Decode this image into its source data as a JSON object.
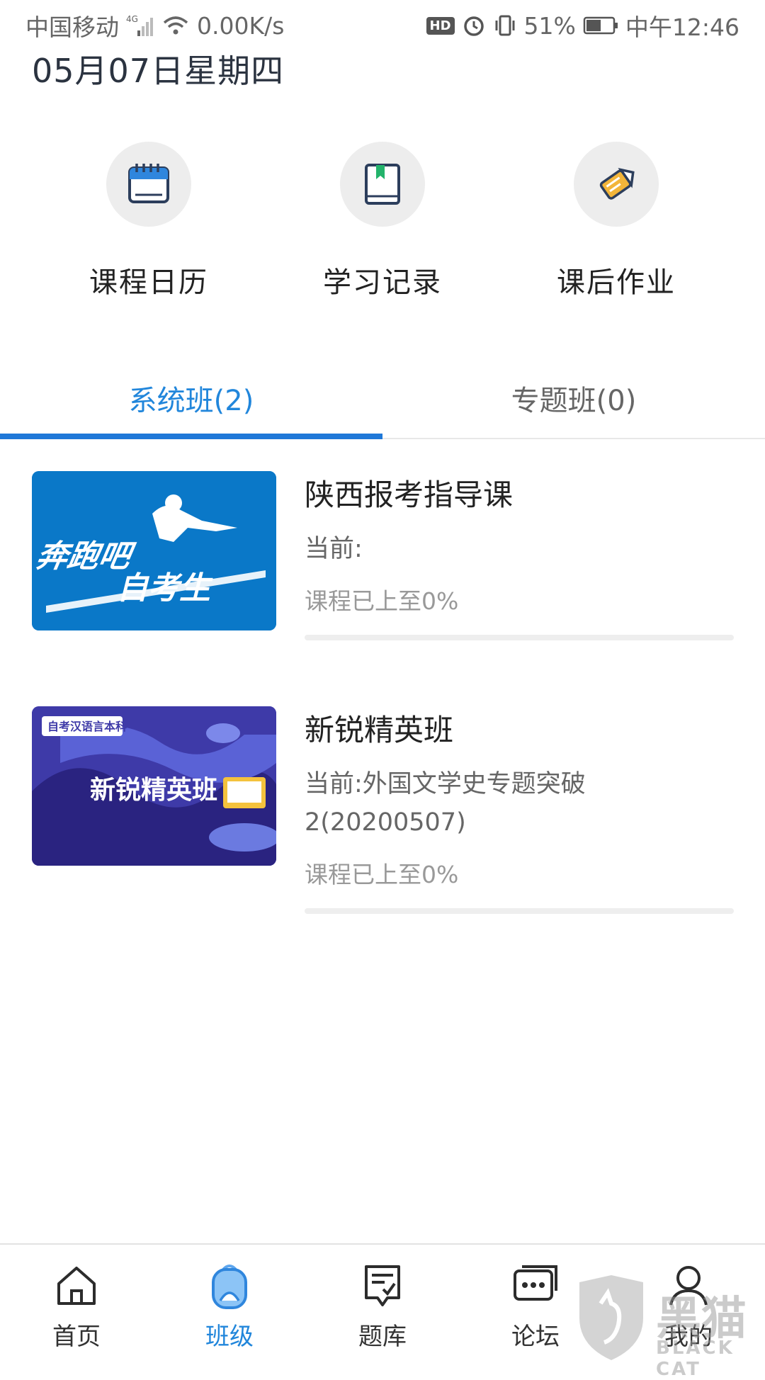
{
  "status_bar": {
    "carrier": "中国移动",
    "network": "4G",
    "speed": "0.00K/s",
    "hd": "HD",
    "battery": "51%",
    "time": "中午12:46"
  },
  "header": {
    "date": "05月07日星期四"
  },
  "quick_actions": [
    {
      "label": "课程日历",
      "icon": "calendar-icon"
    },
    {
      "label": "学习记录",
      "icon": "book-icon"
    },
    {
      "label": "课后作业",
      "icon": "pencil-icon"
    }
  ],
  "tabs": [
    {
      "label": "系统班(2)",
      "active": true
    },
    {
      "label": "专题班(0)",
      "active": false
    }
  ],
  "courses": [
    {
      "title": "陕西报考指导课",
      "current": "当前:",
      "progress_text": "课程已上至0%",
      "progress": 0,
      "thumb_text_1": "奔跑吧",
      "thumb_text_2": "自考生",
      "thumb_bg": "#0a78c8"
    },
    {
      "title": "新锐精英班",
      "current": "当前:外国文学史专题突破",
      "current_line2": "2(20200507)",
      "progress_text": "课程已上至0%",
      "progress": 0,
      "thumb_tag": "自考汉语言本科",
      "thumb_text": "新锐精英班",
      "thumb_bg": "#3e3aa8"
    }
  ],
  "bottom_nav": [
    {
      "label": "首页",
      "icon": "home-icon",
      "active": false
    },
    {
      "label": "班级",
      "icon": "backpack-icon",
      "active": true
    },
    {
      "label": "题库",
      "icon": "question-bank-icon",
      "active": false
    },
    {
      "label": "论坛",
      "icon": "chat-icon",
      "active": false
    },
    {
      "label": "我的",
      "icon": "user-icon",
      "active": false
    }
  ],
  "watermark": {
    "text": "黑猫",
    "sub": "BLACK CAT"
  },
  "colors": {
    "accent": "#2186db",
    "indicator": "#1f78d8"
  }
}
